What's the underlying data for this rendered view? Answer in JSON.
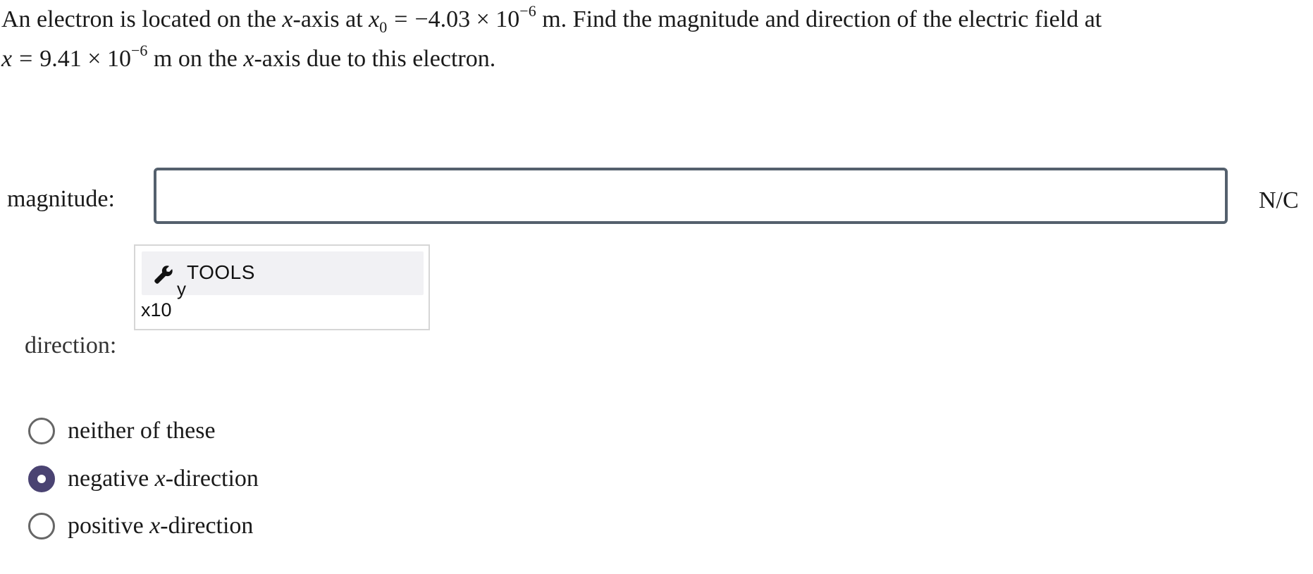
{
  "question": {
    "line1_a": "An electron is located on the ",
    "var_x": "x",
    "line1_b": "-axis at ",
    "var_x0": "x",
    "sub_0": "0",
    "eq_sign": "=",
    "x0_value": "−4.03 × 10",
    "exp1": "−6",
    "line1_c": " m. Find the magnitude and direction of the electric field at",
    "line2_var_x": "x",
    "line2_eq": "=",
    "x_value": "9.41 × 10",
    "exp2": "−6",
    "line2_b": " m on the ",
    "line2_var_x2": "x",
    "line2_c": "-axis due to this electron."
  },
  "magnitude": {
    "label": "magnitude:",
    "value": "",
    "unit": "N/C"
  },
  "tools": {
    "label": "TOOLS",
    "subscript": "y",
    "x10": "x10"
  },
  "direction": {
    "label": "direction:",
    "options": [
      {
        "pre": "neither of these",
        "var": "",
        "post": "",
        "selected": false
      },
      {
        "pre": "negative ",
        "var": "x",
        "post": "-direction",
        "selected": true
      },
      {
        "pre": "positive ",
        "var": "x",
        "post": "-direction",
        "selected": false
      }
    ]
  },
  "colors": {
    "radio_selected": "#4a4372",
    "input_border": "#54606d",
    "tools_bar_bg": "#f1f1f4"
  },
  "icons": {
    "tools": "wrench-icon"
  }
}
